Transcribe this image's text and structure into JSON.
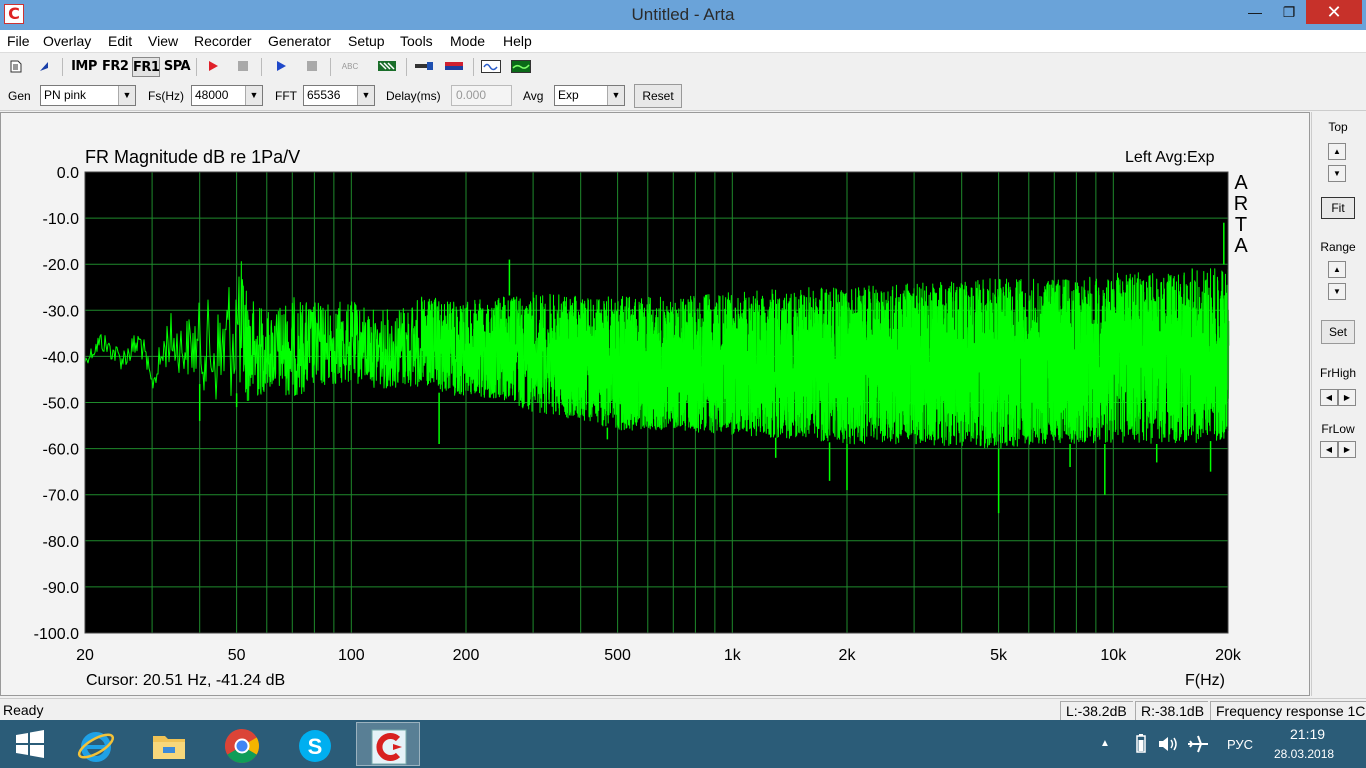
{
  "window": {
    "title": "Untitled - Arta",
    "app_icon_glyph": "C"
  },
  "title_buttons": {
    "minimize": "—",
    "maximize": "❐",
    "close": "✕"
  },
  "menu": [
    "File",
    "Overlay",
    "Edit",
    "View",
    "Recorder",
    "Generator",
    "Setup",
    "Tools",
    "Mode",
    "Help"
  ],
  "toolbar": {
    "imp": "IMP",
    "fr2": "FR2",
    "fr1": "FR1",
    "spa": "SPA",
    "abc": "ABC",
    "icons": [
      "new-file-icon",
      "open-icon",
      "record-icon",
      "stop-icon",
      "play-icon",
      "stop-icon",
      "abc-icon",
      "color-icon",
      "probe-icon",
      "flag-icon",
      "oscilloscope-icon",
      "analyzer-icon"
    ]
  },
  "controls": {
    "gen_label": "Gen",
    "gen_value": "PN pink",
    "fs_label": "Fs(Hz)",
    "fs_value": "48000",
    "fft_label": "FFT",
    "fft_value": "65536",
    "delay_label": "Delay(ms)",
    "delay_value": "0.000",
    "avg_label": "Avg",
    "avg_value": "Exp",
    "reset_label": "Reset"
  },
  "plot": {
    "title": "FR Magnitude dB re 1Pa/V",
    "status": "Left  Avg:Exp",
    "cursor": "Cursor: 20.51 Hz, -41.24 dB",
    "xunit": "F(Hz)",
    "watermark": [
      "A",
      "R",
      "T",
      "A"
    ],
    "bg_color": "#000000",
    "grid_color": "#1f8a2c",
    "trace_color": "#00ff00"
  },
  "chart_data": {
    "type": "line",
    "title": "FR Magnitude dB re 1Pa/V",
    "xlabel": "F(Hz)",
    "ylabel": "",
    "x_scale": "log",
    "xlim": [
      20,
      20000
    ],
    "ylim": [
      -100,
      0
    ],
    "x_ticks": [
      20,
      50,
      100,
      200,
      500,
      1000,
      2000,
      5000,
      10000,
      20000
    ],
    "x_tick_labels": [
      "20",
      "50",
      "100",
      "200",
      "500",
      "1k",
      "2k",
      "5k",
      "10k",
      "20k"
    ],
    "y_ticks": [
      0,
      -10,
      -20,
      -30,
      -40,
      -50,
      -60,
      -70,
      -80,
      -90,
      -100
    ],
    "y_tick_labels": [
      "0.0",
      "-10.0",
      "-20.0",
      "-30.0",
      "-40.0",
      "-50.0",
      "-60.0",
      "-70.0",
      "-80.0",
      "-90.0",
      "-100.0"
    ],
    "grid": true,
    "series": [
      {
        "x": [
          20,
          22,
          25,
          28,
          30,
          33,
          36,
          40,
          45,
          50,
          55,
          60,
          70,
          80,
          100,
          120,
          150,
          200,
          250,
          300,
          400,
          500,
          700,
          1000,
          1500,
          2000,
          3000,
          5000,
          7000,
          10000,
          15000,
          20000
        ],
        "upper": [
          -40,
          -34,
          -38,
          -33,
          -44,
          -30,
          -32,
          -28,
          -27,
          -16,
          -27,
          -30,
          -27,
          -28,
          -28,
          -30,
          -27,
          -28,
          -27,
          -26,
          -27,
          -27,
          -27,
          -26,
          -25,
          -25,
          -24,
          -23,
          -23,
          -22,
          -21,
          -20
        ],
        "lower": [
          -42,
          -39,
          -43,
          -40,
          -48,
          -42,
          -44,
          -46,
          -52,
          -48,
          -51,
          -47,
          -49,
          -47,
          -46,
          -47,
          -47,
          -49,
          -50,
          -52,
          -54,
          -56,
          -56,
          -57,
          -58,
          -59,
          -59,
          -60,
          -59,
          -59,
          -59,
          -58
        ],
        "dips": [
          [
            40,
            -54
          ],
          [
            50,
            -51
          ],
          [
            170,
            -59
          ],
          [
            470,
            -58
          ],
          [
            1300,
            -62
          ],
          [
            1800,
            -67
          ],
          [
            2000,
            -69
          ],
          [
            5000,
            -74
          ],
          [
            7700,
            -64
          ],
          [
            9500,
            -70
          ],
          [
            13000,
            -63
          ],
          [
            18000,
            -65
          ]
        ],
        "peaks": [
          [
            50,
            -16
          ],
          [
            260,
            -19
          ],
          [
            19500,
            -11
          ]
        ]
      }
    ]
  },
  "right_panel": {
    "top_label": "Top",
    "fit_label": "Fit",
    "range_label": "Range",
    "set_label": "Set",
    "frhigh_label": "FrHigh",
    "frlow_label": "FrLow"
  },
  "statusbar": {
    "ready": "Ready",
    "left_level": "L:-38.2dB",
    "right_level": "R:-38.1dB",
    "mode": "Frequency response 1C"
  },
  "taskbar": {
    "apps": [
      "windows-start-icon",
      "internet-explorer-icon",
      "file-explorer-icon",
      "chrome-icon",
      "skype-icon",
      "arta-icon"
    ],
    "lang": "РУС",
    "time": "21:19",
    "date": "28.03.2018"
  }
}
